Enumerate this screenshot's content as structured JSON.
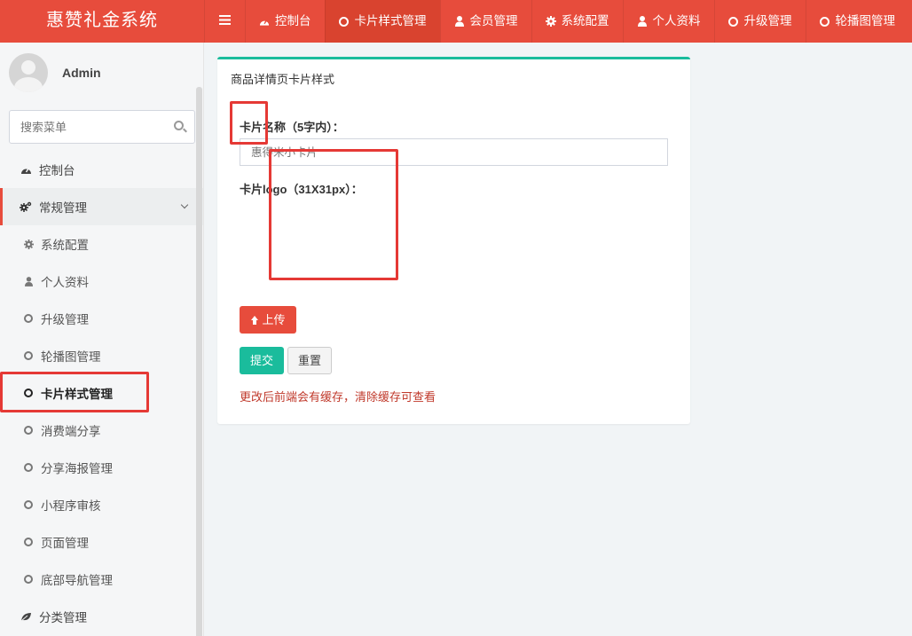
{
  "app": {
    "title": "惠赞礼金系统"
  },
  "topnav": {
    "items": [
      {
        "label": "控制台",
        "icon": "dashboard-icon"
      },
      {
        "label": "卡片样式管理",
        "icon": "circle-icon",
        "active": true
      },
      {
        "label": "会员管理",
        "icon": "user-icon"
      },
      {
        "label": "系统配置",
        "icon": "gear-icon"
      },
      {
        "label": "个人资料",
        "icon": "user-icon"
      },
      {
        "label": "升级管理",
        "icon": "circle-icon"
      },
      {
        "label": "轮播图管理",
        "icon": "circle-icon"
      }
    ]
  },
  "user": {
    "name": "Admin"
  },
  "search": {
    "placeholder": "搜索菜单"
  },
  "sidebar": {
    "dashboard": "控制台",
    "group": "常规管理",
    "subitems": [
      {
        "label": "系统配置",
        "icon": "gear-icon"
      },
      {
        "label": "个人资料",
        "icon": "user-icon"
      },
      {
        "label": "升级管理",
        "icon": "circle-icon"
      },
      {
        "label": "轮播图管理",
        "icon": "circle-icon"
      },
      {
        "label": "卡片样式管理",
        "icon": "circle-icon",
        "current": true
      },
      {
        "label": "消费端分享",
        "icon": "circle-icon"
      },
      {
        "label": "分享海报管理",
        "icon": "circle-icon"
      },
      {
        "label": "小程序审核",
        "icon": "circle-icon"
      },
      {
        "label": "页面管理",
        "icon": "circle-icon"
      },
      {
        "label": "底部导航管理",
        "icon": "circle-icon"
      }
    ],
    "category": "分类管理"
  },
  "panel": {
    "title": "商品详情页卡片样式",
    "name_label": "卡片名称（5字内）：",
    "name_value": "惠得米小卡片",
    "logo_label": "卡片logo（31X31px）：",
    "upload_label": "上传",
    "submit_label": "提交",
    "reset_label": "重置",
    "warning": "更改后前端会有缓存，清除缓存可查看"
  },
  "colors": {
    "brand": "#e74c3c",
    "accent": "#1abc9c",
    "warning": "#c0392b",
    "highlight": "#e53935"
  }
}
